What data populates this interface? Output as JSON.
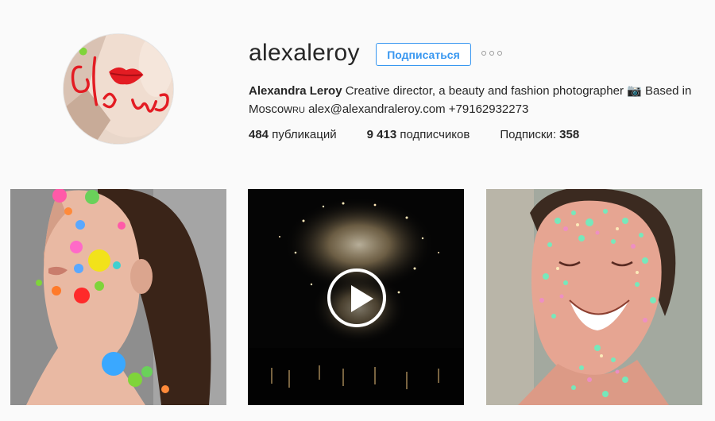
{
  "profile": {
    "username": "alexaleroy",
    "follow_label": "Подписаться",
    "full_name": "Alexandra Leroy",
    "bio_line1": "Creative director, a beauty and fashion photographer",
    "bio_camera": "📷",
    "bio_based": "Based in",
    "bio_city": "Moscow",
    "bio_country": "RU",
    "email": "alex@alexandraleroy.com",
    "phone": "+79162932273",
    "avatar_text": "Glow"
  },
  "stats": {
    "posts_count": "484",
    "posts_label": "публикаций",
    "followers_count": "9 413",
    "followers_label": "подписчиков",
    "following_label": "Подписки:",
    "following_count": "358"
  },
  "colors": {
    "accent": "#3897f0",
    "text": "#262626",
    "background": "#fafafa"
  },
  "posts": [
    {
      "type": "photo",
      "icon": ""
    },
    {
      "type": "video",
      "icon": "play-icon"
    },
    {
      "type": "photo",
      "icon": ""
    }
  ]
}
